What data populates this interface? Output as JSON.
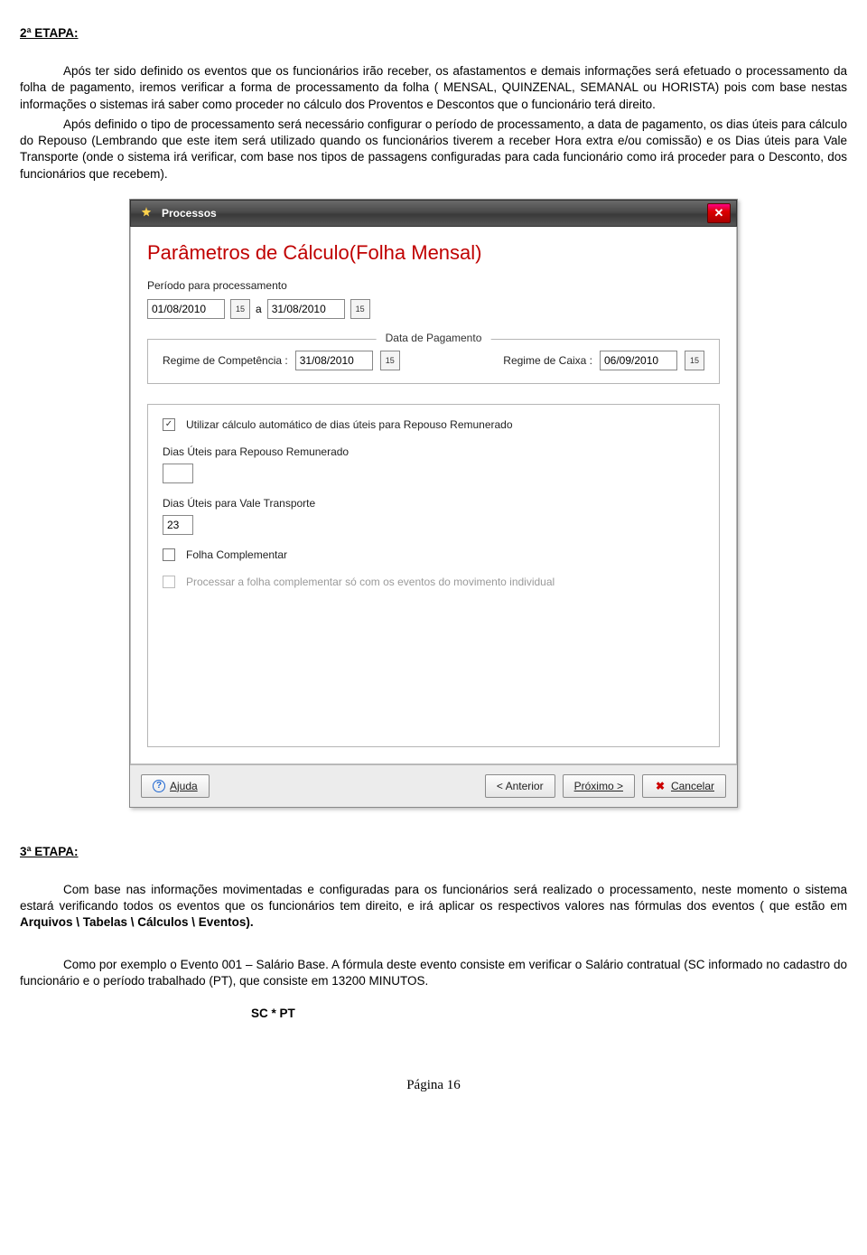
{
  "doc": {
    "stage2_title": "2ª ETAPA:",
    "stage2_p1": "Após ter sido definido os eventos que os funcionários irão receber, os afastamentos e demais informações será efetuado o processamento da folha de pagamento, iremos verificar a forma de processamento da folha ( MENSAL, QUINZENAL, SEMANAL ou HORISTA) pois com base nestas informações o sistemas irá saber como proceder no cálculo dos Proventos e Descontos que o funcionário terá direito.",
    "stage2_p2": "Após definido o tipo de processamento será necessário configurar o período de processamento, a data de pagamento, os dias úteis para cálculo do Repouso (Lembrando que este item será utilizado quando os funcionários tiverem a receber Hora extra e/ou comissão) e os Dias úteis para Vale Transporte (onde o sistema irá verificar, com base nos tipos de passagens configuradas para cada funcionário como irá proceder para o Desconto, dos funcionários que recebem).",
    "stage3_title": "3ª ETAPA:",
    "stage3_p1_a": "Com base nas informações movimentadas e configuradas para os funcionários será realizado o processamento, neste momento o sistema estará verificando todos os eventos que os funcionários tem direito, e irá aplicar os respectivos valores nas fórmulas dos eventos ( que estão em ",
    "stage3_p1_b": "Arquivos \\ Tabelas \\ Cálculos \\ Eventos).",
    "stage3_p2": "Como por exemplo o Evento 001 – Salário Base. A fórmula deste evento consiste em verificar o Salário contratual (SC informado no cadastro do funcionário e o período trabalhado (PT), que consiste em 13200 MINUTOS.",
    "formula": "SC * PT",
    "page_footer": "Página 16"
  },
  "dialog": {
    "title": "Processos",
    "heading": "Parâmetros de Cálculo(Folha Mensal)",
    "period_label": "Período para processamento",
    "period_from": "01/08/2010",
    "period_sep": "a",
    "period_to": "31/08/2010",
    "fieldset_legend": "Data de Pagamento",
    "regime_comp_label": "Regime de Competência :",
    "regime_comp_date": "31/08/2010",
    "regime_caixa_label": "Regime de Caixa :",
    "regime_caixa_date": "06/09/2010",
    "chk_auto_label": "Utilizar cálculo automático de dias úteis para Repouso Remunerado",
    "chk_auto_checked": true,
    "dias_repouso_label": "Dias Úteis para Repouso Remunerado",
    "dias_repouso_value": "",
    "dias_vale_label": "Dias Úteis para Vale Transporte",
    "dias_vale_value": "23",
    "chk_folhacomp_label": "Folha Complementar",
    "chk_folhacomp_checked": false,
    "chk_processar_label": "Processar a folha complementar só com os eventos do movimento individual",
    "buttons": {
      "help": "Ajuda",
      "prev": "< Anterior",
      "next": "Próximo >",
      "cancel": "Cancelar"
    }
  }
}
